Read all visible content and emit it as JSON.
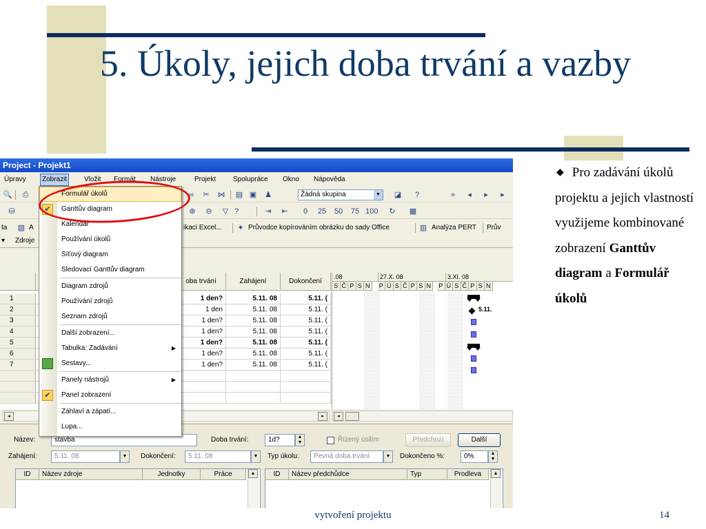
{
  "slide": {
    "title": "5. Úkoly, jejich doba trvání a vazby",
    "bullet_intro": "Pro zadávání úkolů projektu a jejich vlastností využijeme kombinované zobrazení",
    "bullet_bold1": "Ganttův diagram",
    "bullet_mid": "a",
    "bullet_bold2": "Formulář úkolů",
    "footer_text": "vytvoření projektu",
    "page_number": "14"
  },
  "app": {
    "window_title": "Project - Projekt1",
    "menu": [
      "Úpravy",
      "Zobrazit",
      "Vložit",
      "Formát",
      "Nástroje",
      "Projekt",
      "Spolupráce",
      "Okno",
      "Nápověda"
    ],
    "toolbar": {
      "group_combo": "Žádná skupina",
      "excel_text": "ikaci Excel...",
      "wizard_text": "Průvodce kopírováním obrázku do sady Office",
      "pert_text": "Analýza PERT",
      "pru_text": "Prův",
      "ta_text": "ta",
      "a_text": "A",
      "zdroje_text": "Zdroje"
    },
    "icons": [
      "printer-icon",
      "link-icon",
      "unlink-icon",
      "task-info-icon",
      "notes-icon",
      "assign-resources-icon",
      "help-icon",
      "filter-icon",
      "zoom-in-icon",
      "zoom-out-icon",
      "indent-icon",
      "outdent-icon",
      "progress-0-icon",
      "progress-25-icon",
      "progress-50-icon",
      "progress-75-icon",
      "progress-100-icon"
    ],
    "dropdown": {
      "items": [
        "Formulář úkolů",
        "Ganttův diagram",
        "Kalendář",
        "Používání úkolů",
        "Síťový diagram",
        "Sledovací Ganttův diagram",
        "Diagram zdrojů",
        "Používání zdrojů",
        "Seznam zdrojů",
        "Další zobrazení...",
        "Tabulka: Zadávání",
        "Sestavy...",
        "Panely nástrojů",
        "Panel zobrazení",
        "Záhlaví a zápatí...",
        "Lupa..."
      ]
    },
    "grid": {
      "headers": [
        "oba trvání",
        "Zahájení",
        "Dokončení"
      ],
      "rows": [
        {
          "id": "1",
          "duration": "1 den?",
          "start": "5.11. 08",
          "finish": "5.11. (",
          "bold": true
        },
        {
          "id": "2",
          "duration": "1 den",
          "start": "5.11. 08",
          "finish": "5.11. (",
          "bold": false
        },
        {
          "id": "3",
          "duration": "1 den?",
          "start": "5.11. 08",
          "finish": "5.11. (",
          "bold": false
        },
        {
          "id": "4",
          "duration": "1 den?",
          "start": "5.11. 08",
          "finish": "5.11. (",
          "bold": false
        },
        {
          "id": "5",
          "duration": "1 den?",
          "start": "5.11. 08",
          "finish": "5.11. (",
          "bold": true
        },
        {
          "id": "6",
          "duration": "1 den?",
          "start": "5.11. 08",
          "finish": "5.11. (",
          "bold": false
        },
        {
          "id": "7",
          "duration": "1 den?",
          "start": "5.11. 08",
          "finish": "5.11. (",
          "bold": false
        }
      ]
    },
    "gantt": {
      "weeks": [
        ".08",
        "27.X. 08",
        "3.XI. 08"
      ],
      "days": [
        "S",
        "Č",
        "P",
        "S",
        "N",
        "P",
        "Ú",
        "S",
        "Č",
        "P",
        "S",
        "N",
        "P",
        "Ú",
        "S",
        "Č",
        "P",
        "S",
        "N"
      ],
      "milestone_label": "5.11."
    },
    "form": {
      "name_label": "Název:",
      "name_value": "stavba",
      "duration_label": "Doba trvání:",
      "duration_value": "1d?",
      "effort_label": "Řízený úsilím",
      "predecessors_btn": "Předchozí",
      "next_btn": "Další",
      "start_label": "Zahájení:",
      "start_value": "5.11. 08",
      "finish_label": "Dokončení:",
      "finish_value": "5.11. 08",
      "type_label": "Typ úkolu:",
      "type_value": "Pevná doba trvání",
      "complete_label": "Dokončeno %:",
      "complete_value": "0%",
      "res_headers": [
        "ID",
        "Název zdroje",
        "Jednotky",
        "Práce"
      ],
      "pred_headers": [
        "ID",
        "Název předchůdce",
        "Typ",
        "Prodleva"
      ]
    }
  }
}
